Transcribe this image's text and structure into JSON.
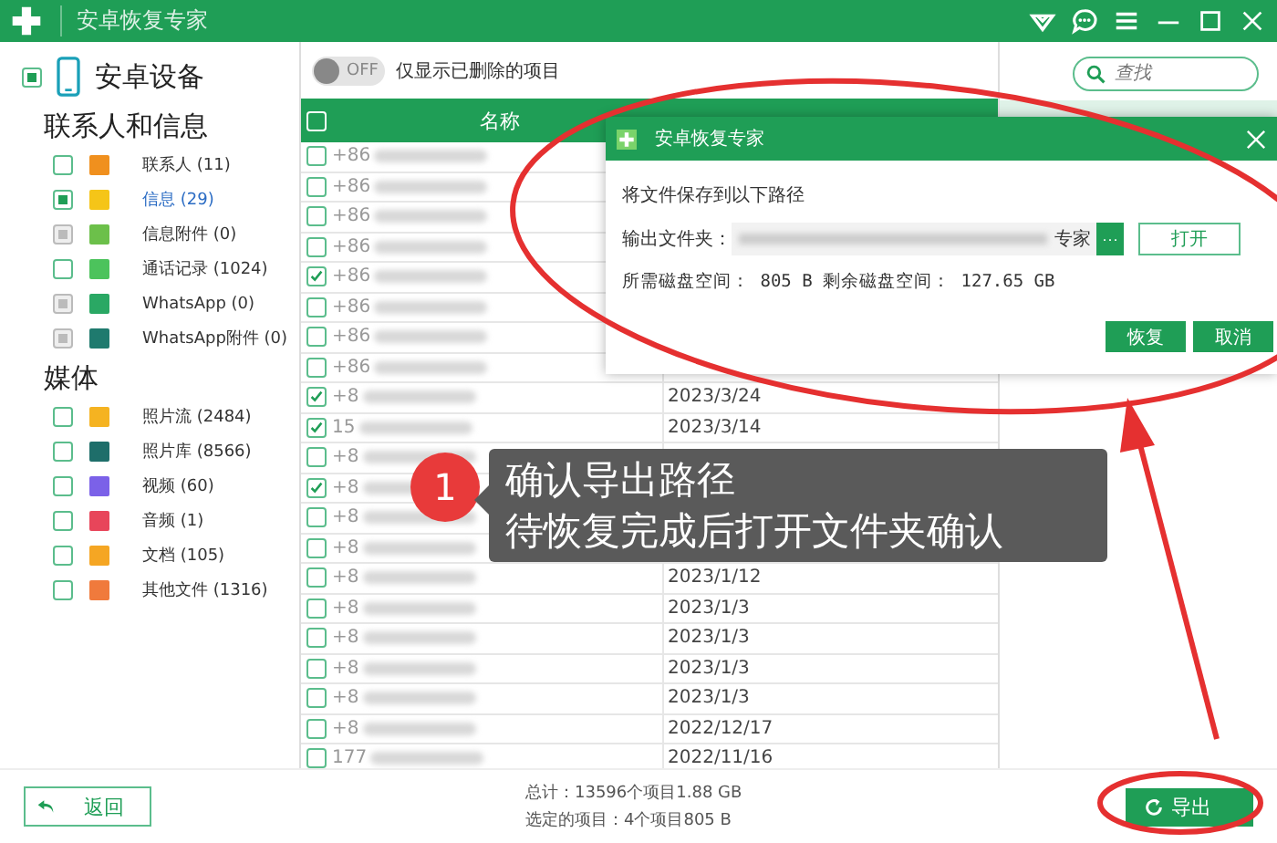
{
  "window": {
    "title": "安卓恢复专家"
  },
  "sidebar": {
    "device": {
      "label": "安卓设备",
      "checked": true
    },
    "groups": [
      {
        "title": "联系人和信息",
        "items": [
          {
            "label": "联系人 (11)",
            "checked": false,
            "disabled": false,
            "selected": false,
            "color": "#f0901e"
          },
          {
            "label": "信息 (29)",
            "checked": true,
            "disabled": false,
            "selected": true,
            "color": "#f5c518"
          },
          {
            "label": "信息附件 (0)",
            "checked": true,
            "disabled": true,
            "selected": false,
            "color": "#6cc04a"
          },
          {
            "label": "通话记录 (1024)",
            "checked": false,
            "disabled": false,
            "selected": false,
            "color": "#4cc35c"
          },
          {
            "label": "WhatsApp (0)",
            "checked": true,
            "disabled": true,
            "selected": false,
            "color": "#2aa864"
          },
          {
            "label": "WhatsApp附件 (0)",
            "checked": true,
            "disabled": true,
            "selected": false,
            "color": "#1f7a6e"
          }
        ]
      },
      {
        "title": "媒体",
        "items": [
          {
            "label": "照片流 (2484)",
            "checked": false,
            "disabled": false,
            "selected": false,
            "color": "#f5b321"
          },
          {
            "label": "照片库 (8566)",
            "checked": false,
            "disabled": false,
            "selected": false,
            "color": "#1e6e6a"
          },
          {
            "label": "视频 (60)",
            "checked": false,
            "disabled": false,
            "selected": false,
            "color": "#7b61e8"
          },
          {
            "label": "音频 (1)",
            "checked": false,
            "disabled": false,
            "selected": false,
            "color": "#e8455a"
          },
          {
            "label": "文档 (105)",
            "checked": false,
            "disabled": false,
            "selected": false,
            "color": "#f5a623"
          },
          {
            "label": "其他文件 (1316)",
            "checked": false,
            "disabled": false,
            "selected": false,
            "color": "#f07a3c"
          }
        ]
      }
    ]
  },
  "filter": {
    "toggle_label": "OFF",
    "on": false,
    "label": "仅显示已删除的项目"
  },
  "search": {
    "placeholder": "查找"
  },
  "table": {
    "all_checked": false,
    "columns": [
      "名称"
    ],
    "rows": [
      {
        "name": "+86",
        "checked": false
      },
      {
        "name": "+86",
        "checked": false
      },
      {
        "name": "+86",
        "checked": false
      },
      {
        "name": "+86",
        "checked": false
      },
      {
        "name": "+86",
        "checked": true
      },
      {
        "name": "+86",
        "checked": false
      },
      {
        "name": "+86",
        "checked": false
      },
      {
        "name": "+86",
        "checked": false
      },
      {
        "name": "+8",
        "date": "2023/3/24",
        "checked": true
      },
      {
        "name": "15",
        "date": "2023/3/14",
        "checked": true
      },
      {
        "name": "+8",
        "checked": false
      },
      {
        "name": "+8",
        "checked": true
      },
      {
        "name": "+8",
        "checked": false
      },
      {
        "name": "+8",
        "checked": false
      },
      {
        "name": "+8",
        "date": "2023/1/12",
        "checked": false
      },
      {
        "name": "+8",
        "date": "2023/1/3",
        "checked": false
      },
      {
        "name": "+8",
        "date": "2023/1/3",
        "checked": false
      },
      {
        "name": "+8",
        "date": "2023/1/3",
        "checked": false
      },
      {
        "name": "+8",
        "date": "2023/1/3",
        "checked": false
      },
      {
        "name": "+8",
        "date": "2022/12/17",
        "checked": false
      },
      {
        "name": "177",
        "date": "2022/11/16",
        "checked": false
      }
    ]
  },
  "dialog": {
    "title": "安卓恢复专家",
    "message": "将文件保存到以下路径",
    "folder_label": "输出文件夹：",
    "folder_value": "专家",
    "browse": "···",
    "open": "打开",
    "space": "所需磁盘空间： 805 B 剩余磁盘空间： 127.65 GB",
    "buttons": [
      "恢复",
      "取消"
    ]
  },
  "tooltip": {
    "step": "1",
    "lines": [
      "确认导出路径",
      "待恢复完成后打开文件夹确认"
    ]
  },
  "footer": {
    "back": "返回",
    "totals": [
      "总计：13596个项目1.88 GB",
      "选定的项目：4个项目805 B"
    ],
    "export": "导出"
  }
}
